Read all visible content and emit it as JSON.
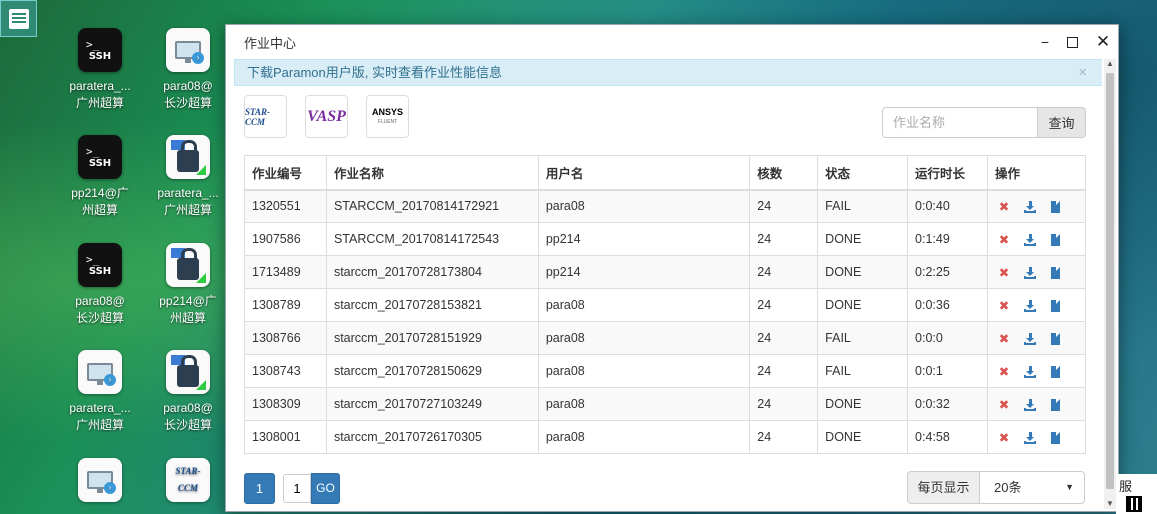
{
  "desktop": {
    "icons": [
      {
        "kind": "ssh",
        "line1": "paratera_...",
        "line2": "广州超算"
      },
      {
        "kind": "rdp",
        "line1": "para08@",
        "line2": "长沙超算"
      },
      {
        "kind": "ssh",
        "line1": "pp214@广",
        "line2": "州超算"
      },
      {
        "kind": "sftp",
        "line1": "paratera_...",
        "line2": "广州超算"
      },
      {
        "kind": "ssh",
        "line1": "para08@",
        "line2": "长沙超算"
      },
      {
        "kind": "sftp",
        "line1": "pp214@广",
        "line2": "州超算"
      },
      {
        "kind": "rdp",
        "line1": "paratera_...",
        "line2": "广州超算"
      },
      {
        "kind": "sftp",
        "line1": "para08@",
        "line2": "长沙超算"
      },
      {
        "kind": "rdp",
        "line1": "",
        "line2": ""
      },
      {
        "kind": "starccm",
        "line1": "",
        "line2": ""
      }
    ],
    "ssh_word": "SSH",
    "ssh_prompt": ">_",
    "starccm_logo": "STAR-CCM",
    "widget_text": "服"
  },
  "window": {
    "title": "作业中心",
    "minimize": "−",
    "close": "✕"
  },
  "alert": {
    "text": "下载Paramon用户版, 实时查看作业性能信息",
    "close": "×"
  },
  "apps": {
    "starccm": "STAR-CCM",
    "vasp": "VASP",
    "ansys": "ANSYS",
    "ansys_sub": "FLUENT"
  },
  "search": {
    "placeholder": "作业名称",
    "button": "查询"
  },
  "table": {
    "headers": [
      "作业编号",
      "作业名称",
      "用户名",
      "核数",
      "状态",
      "运行时长",
      "操作"
    ],
    "rows": [
      {
        "id": "1320551",
        "name": "STARCCM_20170814172921",
        "user": "para08",
        "cores": "24",
        "status": "FAIL",
        "duration": "0:0:40"
      },
      {
        "id": "1907586",
        "name": "STARCCM_20170814172543",
        "user": "pp214",
        "cores": "24",
        "status": "DONE",
        "duration": "0:1:49"
      },
      {
        "id": "1713489",
        "name": "starccm_20170728173804",
        "user": "pp214",
        "cores": "24",
        "status": "DONE",
        "duration": "0:2:25"
      },
      {
        "id": "1308789",
        "name": "starccm_20170728153821",
        "user": "para08",
        "cores": "24",
        "status": "DONE",
        "duration": "0:0:36"
      },
      {
        "id": "1308766",
        "name": "starccm_20170728151929",
        "user": "para08",
        "cores": "24",
        "status": "FAIL",
        "duration": "0:0:0"
      },
      {
        "id": "1308743",
        "name": "starccm_20170728150629",
        "user": "para08",
        "cores": "24",
        "status": "FAIL",
        "duration": "0:0:1"
      },
      {
        "id": "1308309",
        "name": "starccm_20170727103249",
        "user": "para08",
        "cores": "24",
        "status": "DONE",
        "duration": "0:0:32"
      },
      {
        "id": "1308001",
        "name": "starccm_20170726170305",
        "user": "para08",
        "cores": "24",
        "status": "DONE",
        "duration": "0:4:58"
      }
    ],
    "action_delete": "✖"
  },
  "pagination": {
    "current_page": "1",
    "page_input": "1",
    "go": "GO",
    "per_page_label": "每页显示",
    "per_page_value": "20条",
    "caret": "▼"
  },
  "colors": {
    "primary": "#337ab7",
    "danger": "#d9534f",
    "alert_bg": "#d9edf7",
    "alert_text": "#31708f"
  }
}
